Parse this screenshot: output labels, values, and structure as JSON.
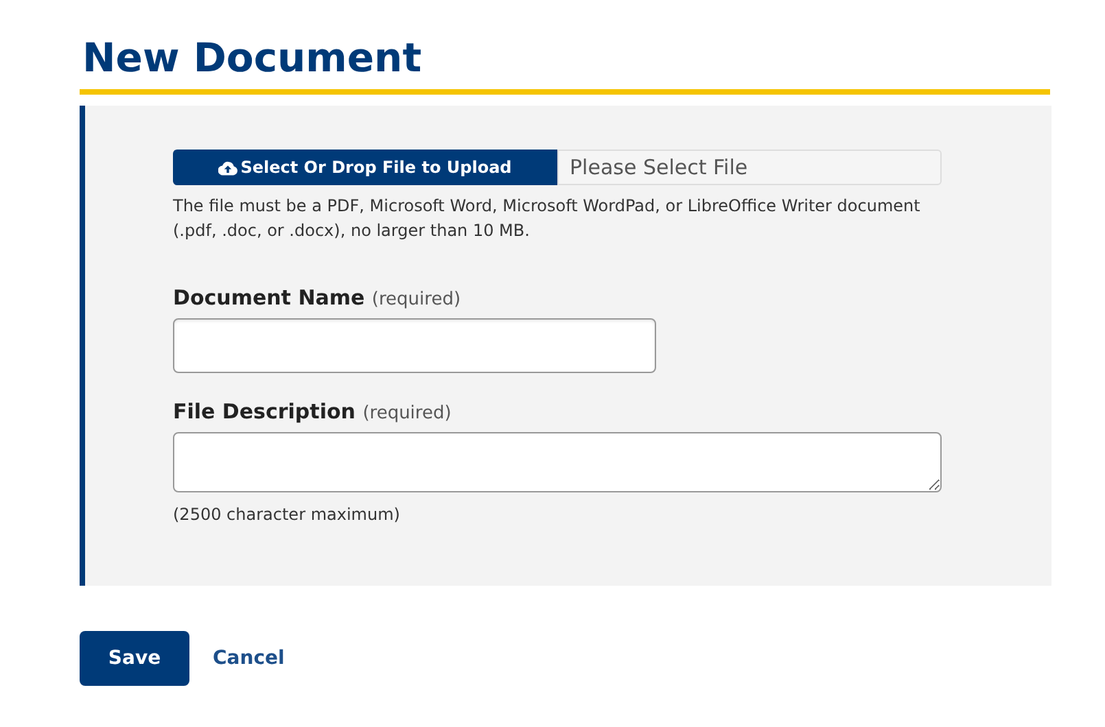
{
  "title": "New Document",
  "upload": {
    "button": "Select Or Drop File to Upload",
    "placeholder": "Please Select File",
    "help": "The file must be a PDF, Microsoft Word, Microsoft WordPad, or LibreOffice Writer document (.pdf, .doc, or .docx), no larger than 10 MB."
  },
  "fields": [
    {
      "kind": "input",
      "label": "Document Name",
      "hint": "(required)"
    },
    {
      "kind": "textarea",
      "label": "File Description",
      "hint": "(required)",
      "note": "(2500 character maximum)"
    }
  ],
  "actions": {
    "save": "Save",
    "cancel": "Cancel"
  }
}
